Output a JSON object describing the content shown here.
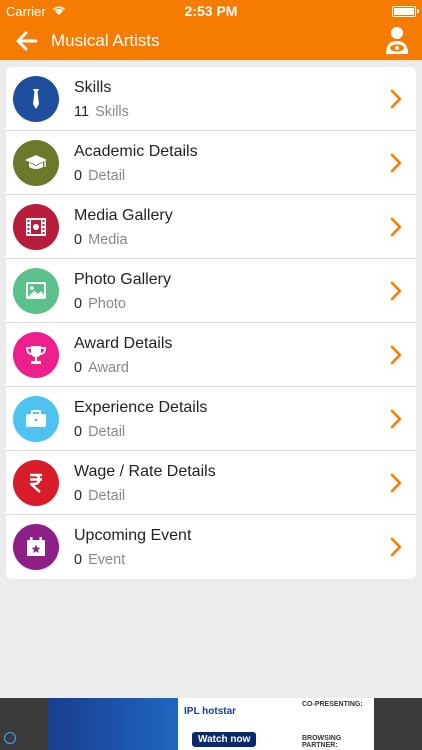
{
  "status_bar": {
    "carrier": "Carrier",
    "time": "2:53 PM"
  },
  "nav": {
    "title": "Musical Artists"
  },
  "rows": [
    {
      "name": "Skills",
      "count": "11",
      "unit": "Skills",
      "icon": "tie-icon",
      "color": "#1f4e9c"
    },
    {
      "name": "Academic Details",
      "count": "0",
      "unit": "Detail",
      "icon": "graduation-cap-icon",
      "color": "#6b7a2a"
    },
    {
      "name": "Media Gallery",
      "count": "0",
      "unit": "Media",
      "icon": "film-icon",
      "color": "#b71c3a"
    },
    {
      "name": "Photo Gallery",
      "count": "0",
      "unit": "Photo",
      "icon": "image-icon",
      "color": "#5cc08a"
    },
    {
      "name": "Award Details",
      "count": "0",
      "unit": "Award",
      "icon": "trophy-icon",
      "color": "#ec1f8d"
    },
    {
      "name": "Experience Details",
      "count": "0",
      "unit": "Detail",
      "icon": "briefcase-icon",
      "color": "#4fc3f0"
    },
    {
      "name": "Wage / Rate Details",
      "count": "0",
      "unit": "Detail",
      "icon": "rupee-icon",
      "color": "#d71e28"
    },
    {
      "name": "Upcoming Event",
      "count": "0",
      "unit": "Event",
      "icon": "calendar-star-icon",
      "color": "#8e1f86"
    }
  ],
  "ad": {
    "brand": "IPL hotstar",
    "cta": "Watch now",
    "copresenting": "CO-PRESENTING:",
    "streaming": "BROWSING PARTNER:"
  },
  "theme": {
    "accent": "#f57c00"
  }
}
